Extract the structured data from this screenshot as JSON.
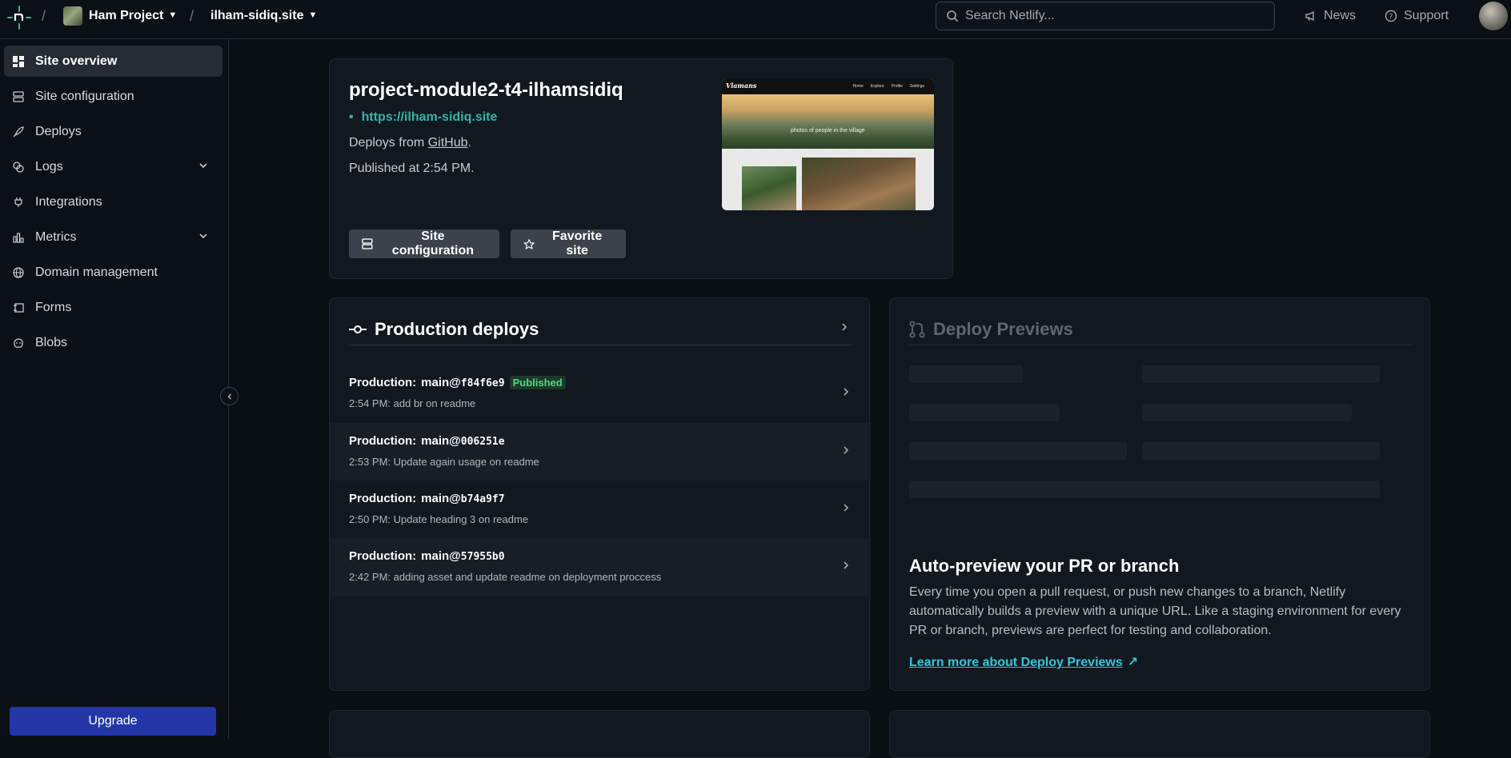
{
  "topbar": {
    "team_name": "Ham Project",
    "site_name": "ilham-sidiq.site",
    "search_placeholder": "Search Netlify...",
    "news_label": "News",
    "support_label": "Support"
  },
  "sidebar": {
    "items": [
      {
        "label": "Site overview",
        "icon": "grid-icon"
      },
      {
        "label": "Site configuration",
        "icon": "server-icon"
      },
      {
        "label": "Deploys",
        "icon": "rocket-icon"
      },
      {
        "label": "Logs",
        "icon": "logs-icon"
      },
      {
        "label": "Integrations",
        "icon": "plug-icon"
      },
      {
        "label": "Metrics",
        "icon": "bar-chart-icon"
      },
      {
        "label": "Domain management",
        "icon": "globe-icon"
      },
      {
        "label": "Forms",
        "icon": "form-icon"
      },
      {
        "label": "Blobs",
        "icon": "blob-icon"
      }
    ],
    "upgrade_label": "Upgrade"
  },
  "overview": {
    "title": "project-module2-t4-ilhamsidiq",
    "url": "https://ilham-sidiq.site",
    "deploys_prefix": "Deploys from",
    "deploys_source": "GitHub",
    "deploys_suffix": ".",
    "published": "Published at 2:54 PM.",
    "config_button": "Site configuration",
    "favorite_button": "Favorite site",
    "preview": {
      "logo": "Vlamans",
      "links": [
        "Home",
        "Explore",
        "Profile",
        "Settings"
      ],
      "hero_text": "photos of people in the village"
    }
  },
  "production": {
    "title": "Production deploys",
    "deploys": [
      {
        "label": "Production:",
        "ref": "main@",
        "hash": "f84f6e9",
        "badge": "Published",
        "sub": "2:54 PM: add br on readme"
      },
      {
        "label": "Production:",
        "ref": "main@",
        "hash": "006251e",
        "badge": "",
        "sub": "2:53 PM: Update again usage on readme"
      },
      {
        "label": "Production:",
        "ref": "main@",
        "hash": "b74a9f7",
        "badge": "",
        "sub": "2:50 PM: Update heading 3 on readme"
      },
      {
        "label": "Production:",
        "ref": "main@",
        "hash": "57955b0",
        "badge": "",
        "sub": "2:42 PM: adding asset and update readme on deployment proccess"
      }
    ]
  },
  "previews": {
    "title": "Deploy Previews",
    "heading": "Auto-preview your PR or branch",
    "body": "Every time you open a pull request, or push new changes to a branch, Netlify automatically builds a preview with a unique URL. Like a staging environment for every PR or branch, previews are perfect for testing and collaboration.",
    "link": "Learn more about Deploy Previews"
  },
  "colors": {
    "accent": "#32b5a8",
    "link": "#2ec8d8",
    "upgrade": "#2236a8",
    "published_badge": "#4ddb82"
  }
}
